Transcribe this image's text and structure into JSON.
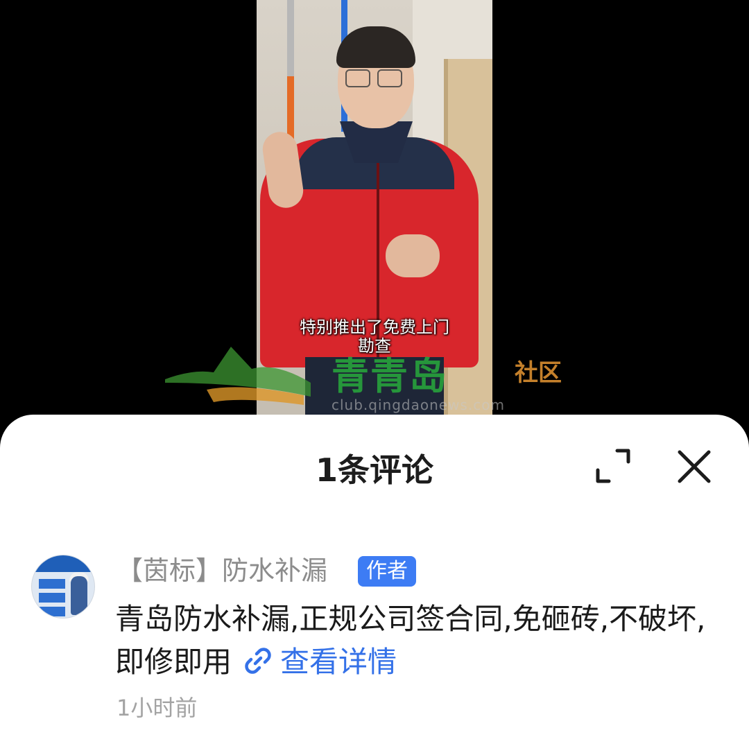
{
  "video": {
    "subtitle_line1": "特别推出了免费上门",
    "subtitle_line2": "勘查",
    "watermark": {
      "brand": "青青岛",
      "suffix": "社区",
      "url": "club.qingdaonews.com"
    }
  },
  "comments_panel": {
    "title": "1条评论",
    "expand_icon": "expand-icon",
    "close_icon": "close-icon",
    "comments": [
      {
        "username": "【茵标】防水补漏",
        "badge": "作者",
        "text": "青岛防水补漏,正规公司签合同,免砸砖,不破坏,即修即用",
        "link_label": "查看详情",
        "link_icon": "link-icon",
        "time": "1小时前"
      }
    ]
  },
  "colors": {
    "badge_blue": "#3d7cf4",
    "link_blue": "#3471e8",
    "watermark_green": "#28aa3c",
    "watermark_orange": "#e69632"
  }
}
